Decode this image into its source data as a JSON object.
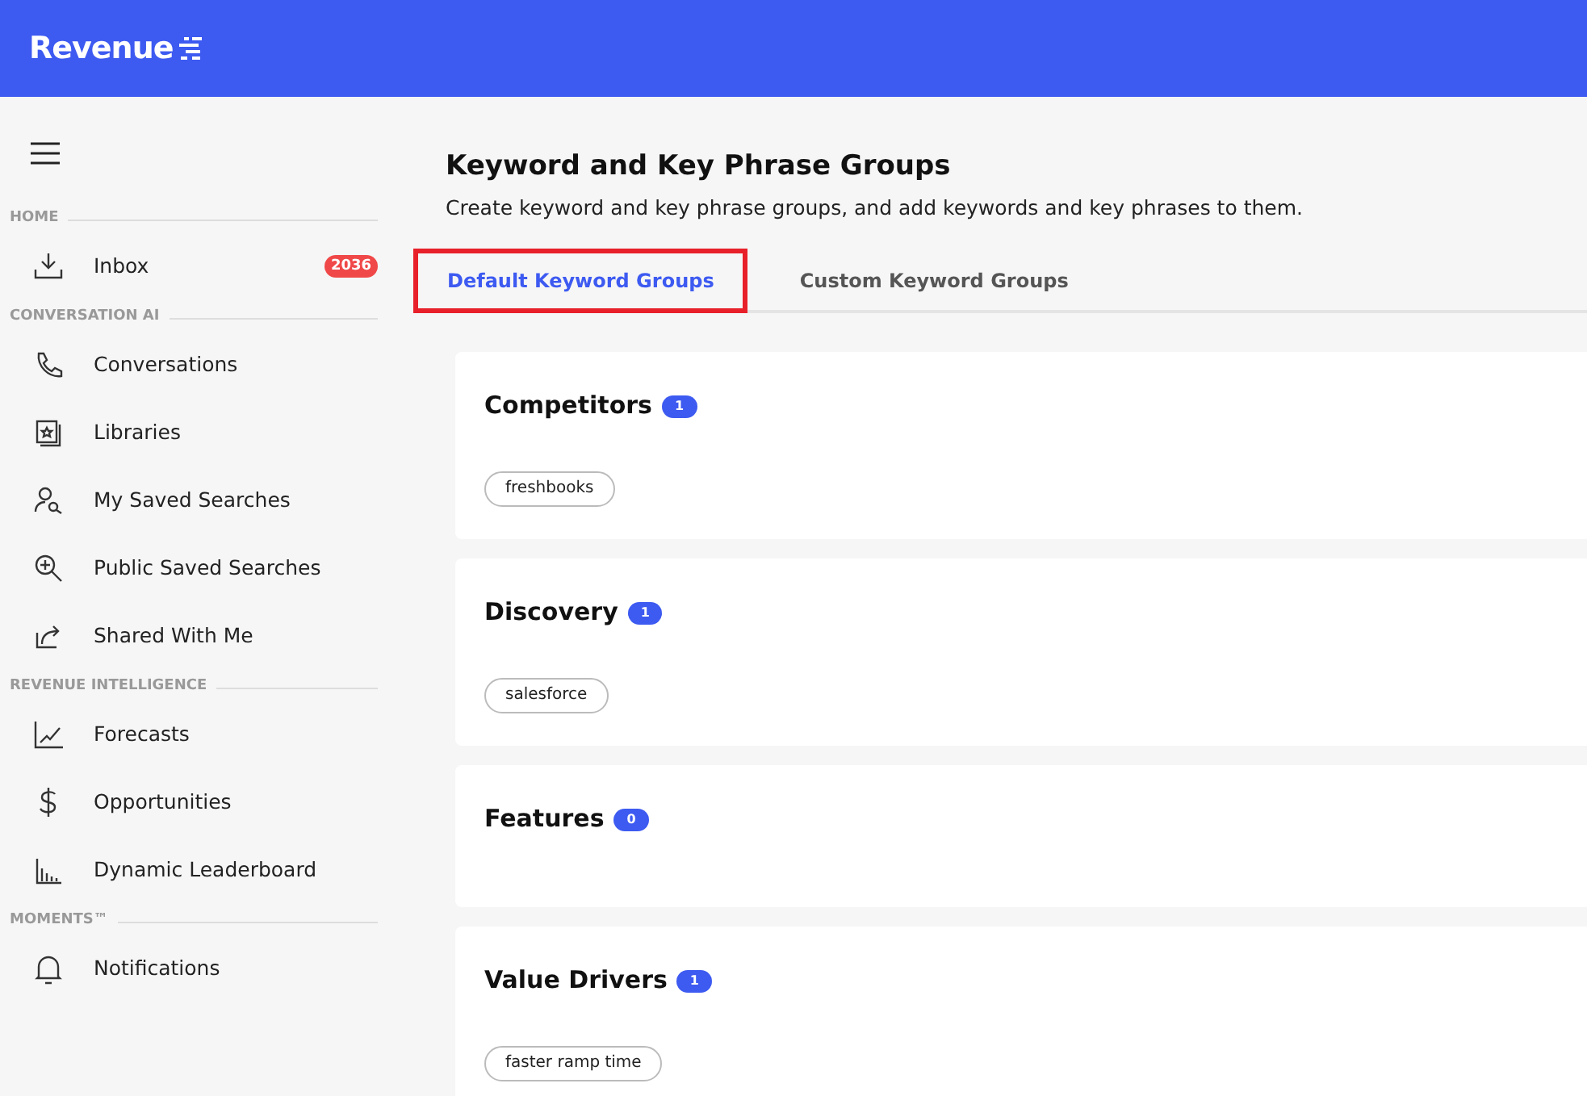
{
  "header": {
    "logo": "Revenue"
  },
  "sidebar": {
    "sections": [
      {
        "title": "HOME",
        "items": [
          {
            "label": "Inbox",
            "badge": "2036"
          }
        ]
      },
      {
        "title": "CONVERSATION AI",
        "items": [
          {
            "label": "Conversations"
          },
          {
            "label": "Libraries"
          },
          {
            "label": "My Saved Searches"
          },
          {
            "label": "Public Saved Searches"
          },
          {
            "label": "Shared With Me"
          }
        ]
      },
      {
        "title": "REVENUE INTELLIGENCE",
        "items": [
          {
            "label": "Forecasts"
          },
          {
            "label": "Opportunities"
          },
          {
            "label": "Dynamic Leaderboard"
          }
        ]
      },
      {
        "title": "MOMENTS™",
        "items": [
          {
            "label": "Notifications"
          }
        ]
      }
    ]
  },
  "page": {
    "title": "Keyword and Key Phrase Groups",
    "subtitle": "Create keyword and key phrase groups, and add keywords and key phrases to them."
  },
  "tabs": [
    {
      "label": "Default Keyword Groups",
      "selected": true,
      "highlighted": true
    },
    {
      "label": "Custom Keyword Groups",
      "selected": false,
      "highlighted": false
    }
  ],
  "groups": [
    {
      "name": "Competitors",
      "count": "1",
      "keywords": [
        "freshbooks"
      ]
    },
    {
      "name": "Discovery",
      "count": "1",
      "keywords": [
        "salesforce"
      ]
    },
    {
      "name": "Features",
      "count": "0"
    },
    {
      "name": "Value Drivers",
      "count": "1",
      "keywords": [
        "faster ramp time"
      ]
    }
  ]
}
